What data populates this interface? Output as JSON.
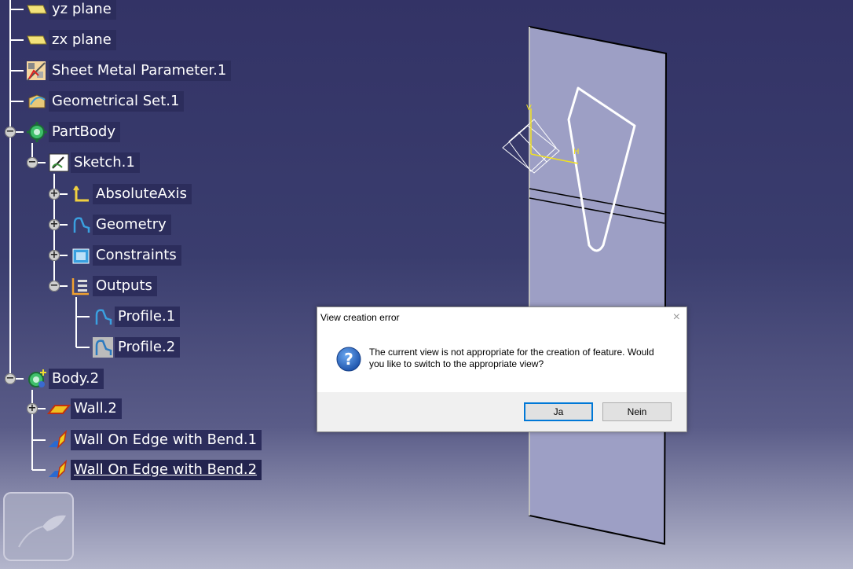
{
  "tree": {
    "items": [
      {
        "label": "yz plane",
        "icon": "plane-icon"
      },
      {
        "label": "zx plane",
        "icon": "plane-icon"
      },
      {
        "label": "Sheet Metal Parameter.1",
        "icon": "sheet-metal-parameter-icon"
      },
      {
        "label": "Geometrical Set.1",
        "icon": "geometrical-set-icon"
      },
      {
        "label": "PartBody",
        "icon": "partbody-gear-icon",
        "toggle": "−"
      },
      {
        "label": "Sketch.1",
        "icon": "sketch-icon",
        "toggle": "−"
      },
      {
        "label": "AbsoluteAxis",
        "icon": "axis-icon",
        "toggle": "+"
      },
      {
        "label": "Geometry",
        "icon": "geometry-icon",
        "toggle": "+"
      },
      {
        "label": "Constraints",
        "icon": "constraints-icon",
        "toggle": "+"
      },
      {
        "label": "Outputs",
        "icon": "outputs-icon",
        "toggle": "−"
      },
      {
        "label": "Profile.1",
        "icon": "profile-icon"
      },
      {
        "label": "Profile.2",
        "icon": "profile-hatched-icon"
      },
      {
        "label": "Body.2",
        "icon": "body-gear-icon",
        "toggle": "−"
      },
      {
        "label": "Wall.2",
        "icon": "wall-icon",
        "toggle": "+"
      },
      {
        "label": "Wall On Edge with Bend.1",
        "icon": "wall-on-edge-icon"
      },
      {
        "label": "Wall On Edge with Bend.2",
        "icon": "wall-on-edge-icon",
        "selected": true
      }
    ]
  },
  "viewport": {
    "axis_labels": {
      "v": "V",
      "h": "H"
    }
  },
  "dialog": {
    "title": "View creation error",
    "close_symbol": "×",
    "message": "The current view is not appropriate for the creation of feature. Would you like to switch to the appropriate view?",
    "yes_label": "Ja",
    "no_label": "Nein"
  },
  "colors": {
    "background_top": "#333366",
    "background_bottom": "#b4b6cc",
    "panel": "#9d9fc5",
    "tree_label_bg": "#2c2d5c",
    "dialog_default_border": "#0078d7"
  }
}
